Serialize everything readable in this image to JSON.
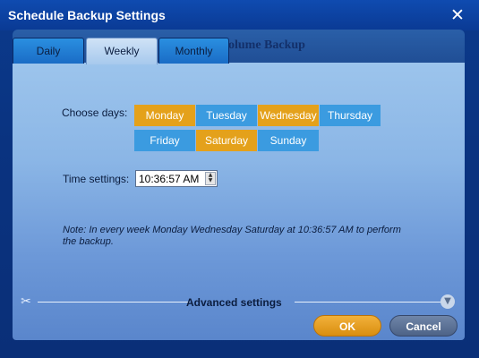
{
  "window": {
    "title": "Schedule Backup Settings",
    "close_label": "✕"
  },
  "background": {
    "partial_text": "olume Backup"
  },
  "tabs": [
    {
      "label": "Daily",
      "active": false
    },
    {
      "label": "Weekly",
      "active": true
    },
    {
      "label": "Monthly",
      "active": false
    }
  ],
  "choose_days": {
    "label": "Choose days:",
    "days": [
      {
        "label": "Monday",
        "selected": true
      },
      {
        "label": "Tuesday",
        "selected": false
      },
      {
        "label": "Wednesday",
        "selected": true
      },
      {
        "label": "Thursday",
        "selected": false
      },
      {
        "label": "Friday",
        "selected": false
      },
      {
        "label": "Saturday",
        "selected": true
      },
      {
        "label": "Sunday",
        "selected": false
      }
    ]
  },
  "time_settings": {
    "label": "Time settings:",
    "value": "10:36:57 AM"
  },
  "note": "Note: In every week Monday Wednesday Saturday at 10:36:57 AM to perform the backup.",
  "advanced": {
    "label": "Advanced settings"
  },
  "buttons": {
    "ok": "OK",
    "cancel": "Cancel"
  },
  "colors": {
    "selected_day": "#e4a11b",
    "unselected_day": "#3b9be0",
    "titlebar": "#0a3a94"
  }
}
